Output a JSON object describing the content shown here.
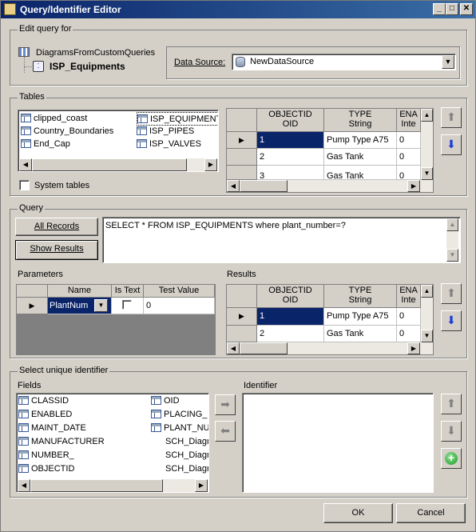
{
  "window": {
    "title": "Query/Identifier Editor"
  },
  "edit_query": {
    "group_label": "Edit query for",
    "tree_parent": "DiagramsFromCustomQueries",
    "tree_child": "ISP_Equipments",
    "data_source_label": "Data Source:",
    "data_source_value": "NewDataSource"
  },
  "tables": {
    "group_label": "Tables",
    "list": [
      "clipped_coast",
      "Country_Boundaries",
      "End_Cap",
      "ISP_EQUIPMENT",
      "ISP_PIPES",
      "ISP_VALVES"
    ],
    "system_tables_label": "System tables",
    "grid": {
      "headers": [
        {
          "name": "OBJECTID",
          "type": "OID"
        },
        {
          "name": "TYPE",
          "type": "String"
        },
        {
          "name": "ENA",
          "type": "Inte"
        }
      ],
      "rows": [
        [
          "1",
          "Pump Type A75",
          "0"
        ],
        [
          "2",
          "Gas Tank",
          "0"
        ],
        [
          "3",
          "Gas Tank",
          "0"
        ]
      ]
    }
  },
  "query": {
    "group_label": "Query",
    "all_records": "All Records",
    "show_results": "Show Results",
    "sql": "SELECT * FROM ISP_EQUIPMENTS where plant_number=?"
  },
  "parameters": {
    "label": "Parameters",
    "headers": [
      "Name",
      "Is Text",
      "Test Value"
    ],
    "row": {
      "name": "PlantNum",
      "is_text": false,
      "test_value": "0"
    }
  },
  "results": {
    "label": "Results",
    "headers": [
      {
        "name": "OBJECTID",
        "type": "OID"
      },
      {
        "name": "TYPE",
        "type": "String"
      },
      {
        "name": "ENA",
        "type": "Inte"
      }
    ],
    "rows": [
      [
        "1",
        "Pump Type A75",
        "0"
      ],
      [
        "2",
        "Gas Tank",
        "0"
      ]
    ]
  },
  "unique_identifier": {
    "group_label": "Select unique identifier",
    "fields_label": "Fields",
    "identifier_label": "Identifier",
    "fields": [
      "CLASSID",
      "ENABLED",
      "MAINT_DATE",
      "MANUFACTURER",
      "NUMBER_",
      "OBJECTID",
      "OID",
      "PLACING_",
      "PLANT_NU",
      "SCH_Diagr",
      "SCH_Diagr",
      "SCH_Diagr"
    ]
  },
  "footer": {
    "ok": "OK",
    "cancel": "Cancel"
  },
  "colors": {
    "selection": "#0a246a",
    "face": "#d4d0c8",
    "title_start": "#0a246a",
    "title_end": "#3a6ea5"
  }
}
